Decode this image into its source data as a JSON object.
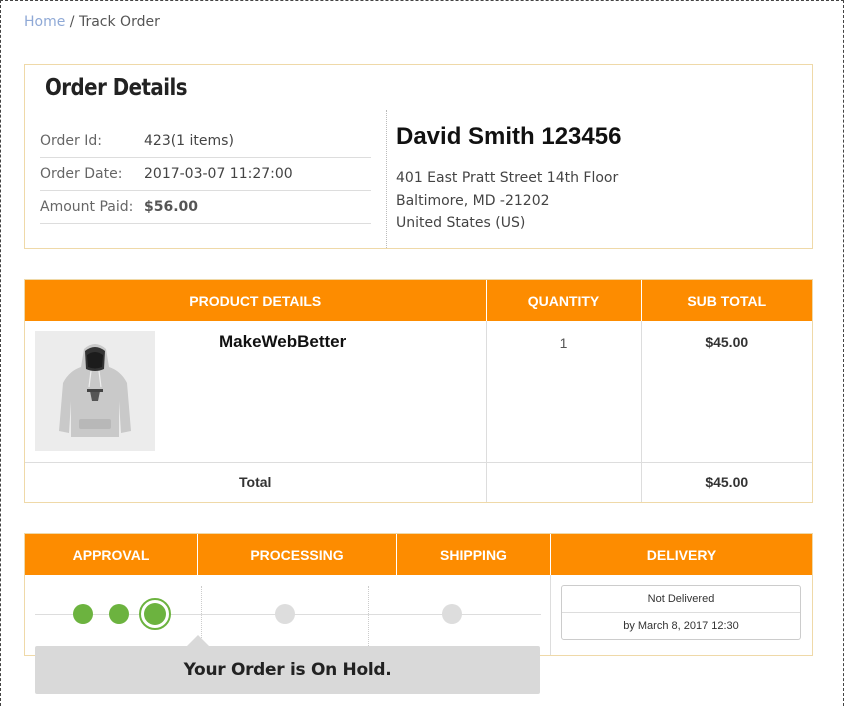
{
  "breadcrumb": {
    "home": "Home",
    "separator": " / ",
    "current": "Track Order"
  },
  "order_details": {
    "title": "Order Details",
    "rows": [
      {
        "label": "Order Id:",
        "value": "423(1 items)"
      },
      {
        "label": "Order Date:",
        "value": "2017-03-07 11:27:00"
      },
      {
        "label": "Amount Paid:",
        "value": "$56.00"
      }
    ],
    "customer": {
      "name": "David Smith 123456",
      "address_line1": "401 East Pratt Street 14th Floor",
      "address_line2": "Baltimore, MD -21202",
      "address_line3": "United States (US)"
    }
  },
  "products": {
    "headers": {
      "details": "PRODUCT DETAILS",
      "quantity": "QUANTITY",
      "subtotal": "SUB TOTAL"
    },
    "items": [
      {
        "name": "MakeWebBetter",
        "quantity": "1",
        "subtotal": "$45.00",
        "image": "hoodie-image"
      }
    ],
    "total_label": "Total",
    "total_value": "$45.00"
  },
  "tracking": {
    "headers": {
      "approval": "APPROVAL",
      "processing": "PROCESSING",
      "shipping": "SHIPPING",
      "delivery": "DELIVERY"
    },
    "steps_state": [
      "done",
      "done",
      "current",
      "pending",
      "pending"
    ],
    "delivery_status": "Not Delivered",
    "delivery_date": "by March 8, 2017 12:30",
    "hold_message": "Your Order is On Hold."
  },
  "colors": {
    "accent": "#fd8c00",
    "success": "#6cb33f",
    "border": "#efd9a8",
    "link": "#8fa9d6"
  }
}
